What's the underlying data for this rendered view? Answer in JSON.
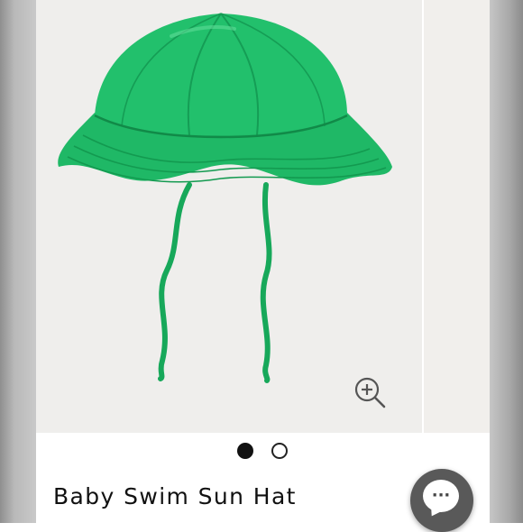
{
  "product": {
    "title": "Baby Swim Sun Hat",
    "image_icon": "green-bucket-hat"
  },
  "gallery": {
    "image_count": 2,
    "active_index": 0,
    "zoom_icon": "zoom-in-icon"
  },
  "chat": {
    "icon": "chat-bubble-icon",
    "glyph": "···"
  },
  "colors": {
    "hat_green": "#1fb866",
    "image_bg": "#efeeec",
    "chat_button": "#595959"
  }
}
